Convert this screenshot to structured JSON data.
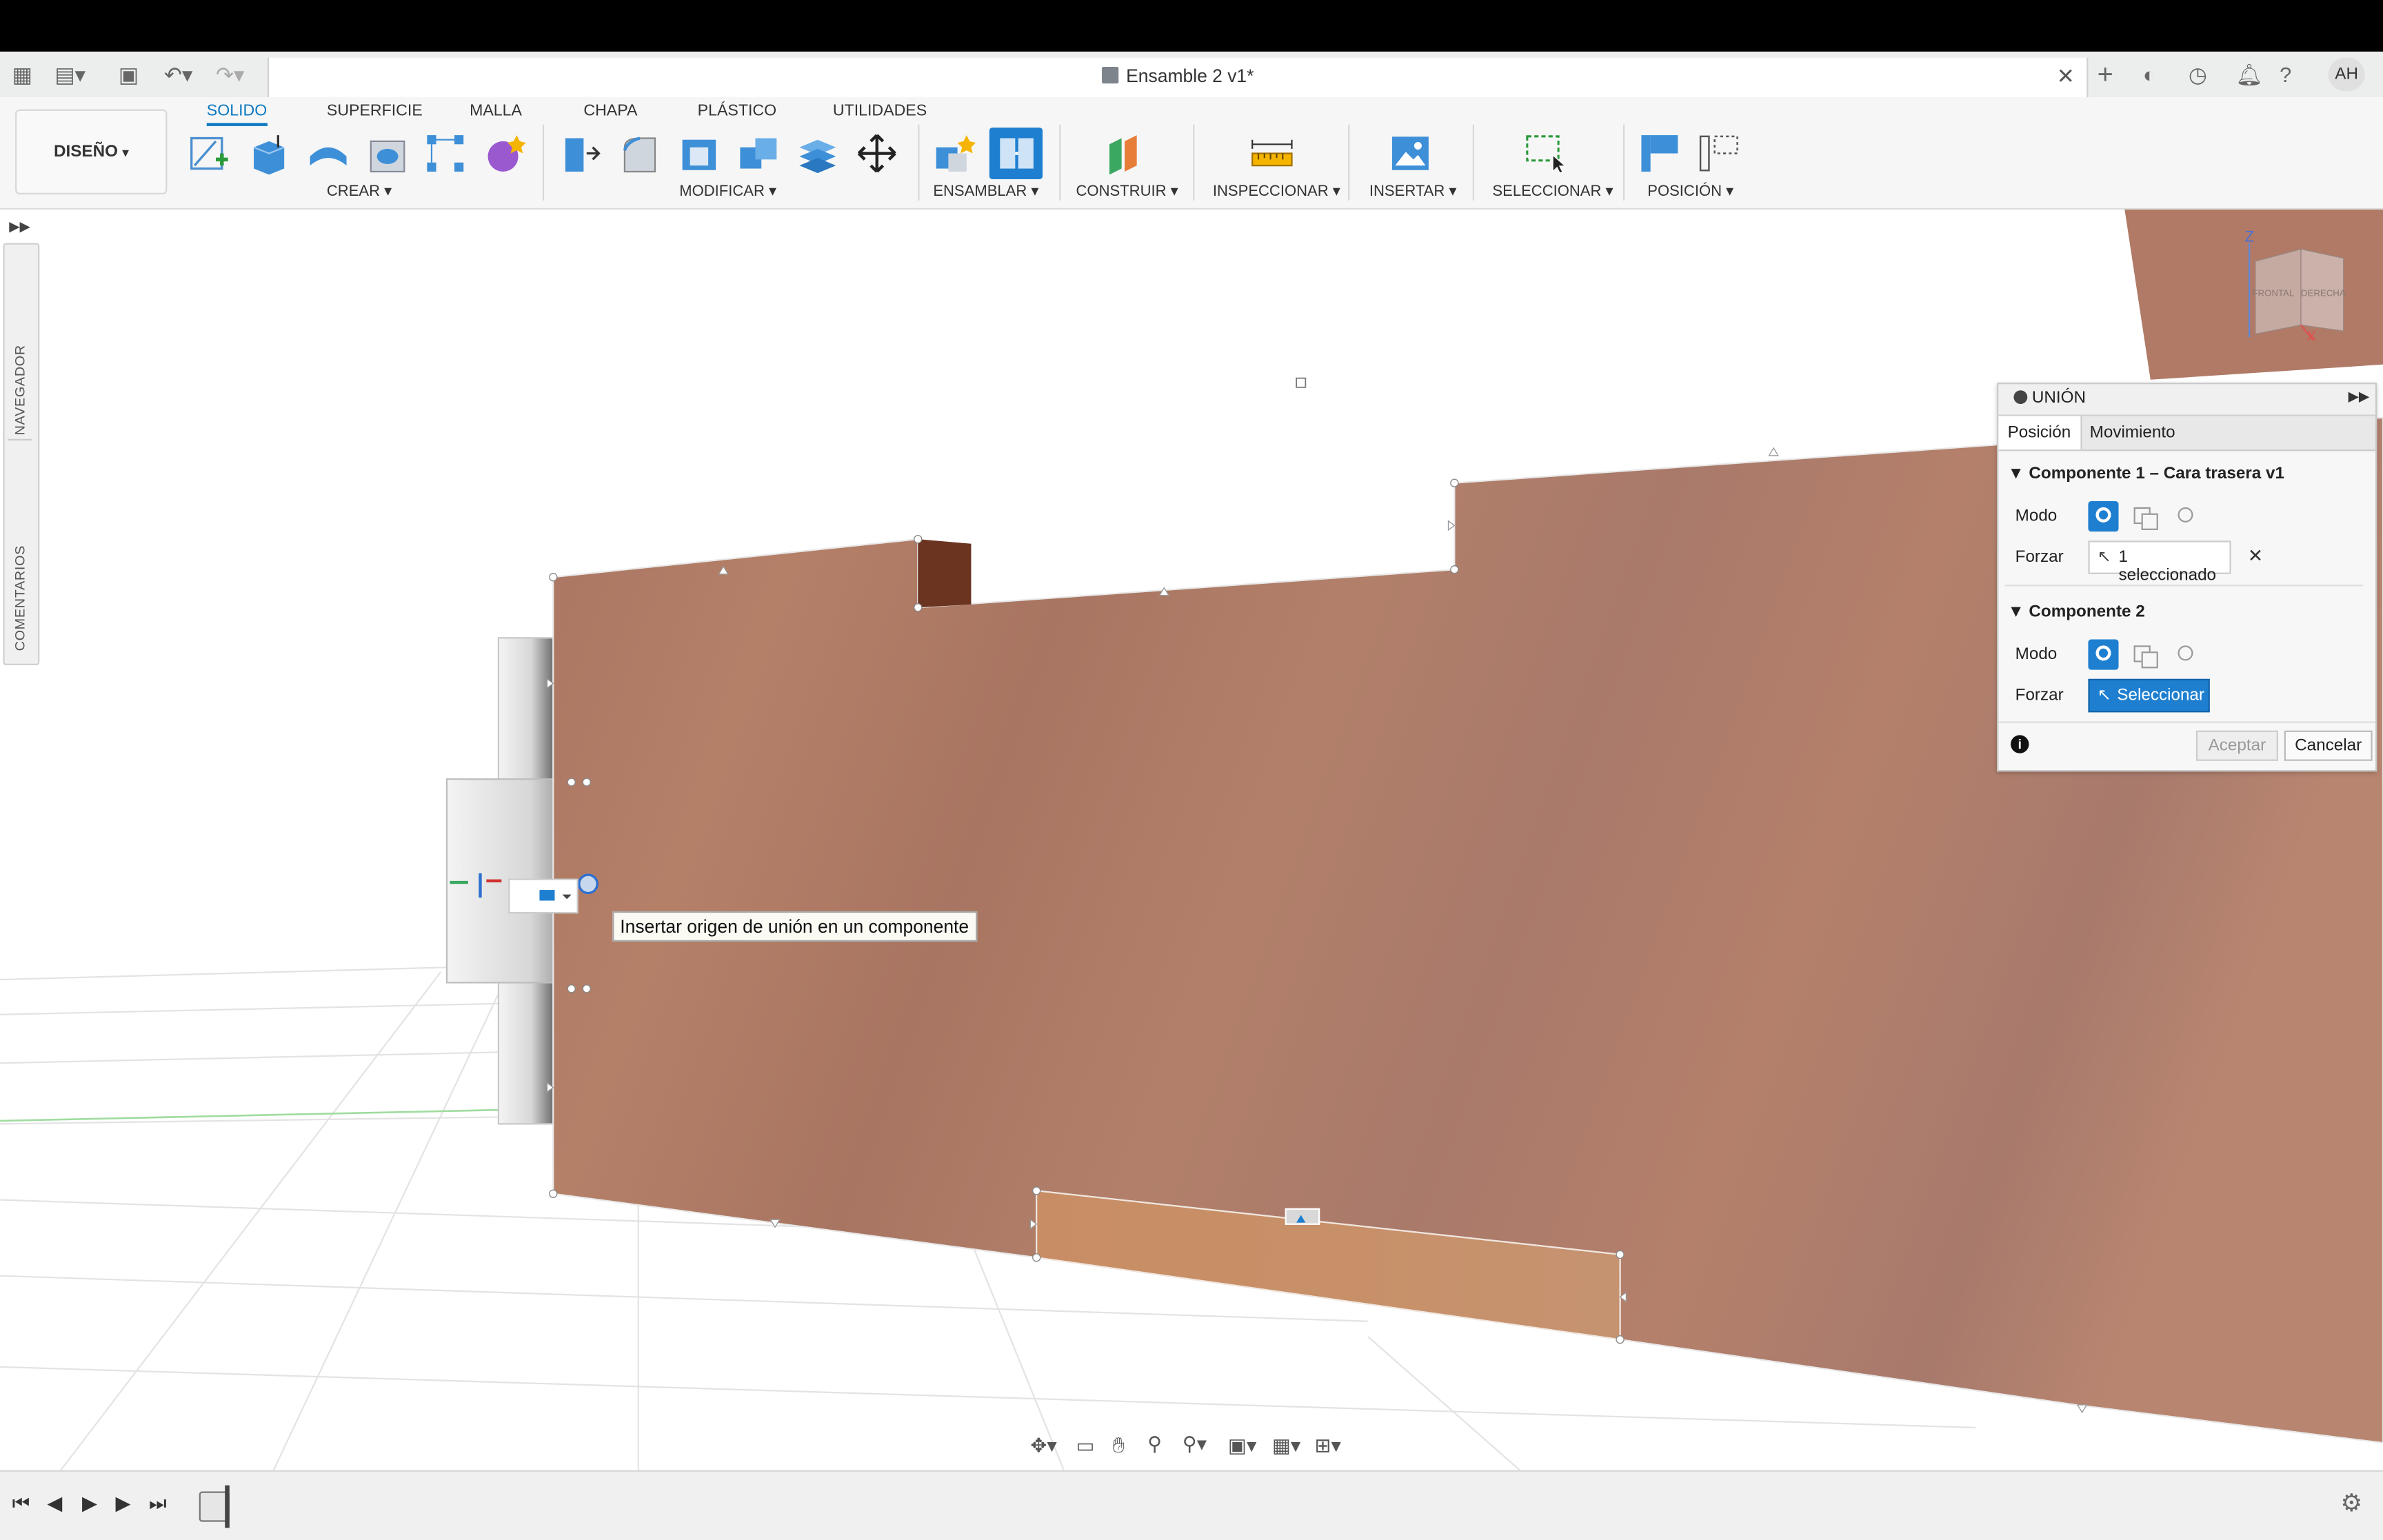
{
  "title_bar": {
    "document_title": "Ensamble 2 v1*",
    "user_initials": "AH"
  },
  "workspace": {
    "label": "DISEÑO"
  },
  "ribbon": {
    "tabs": [
      "SOLIDO",
      "SUPERFICIE",
      "MALLA",
      "CHAPA",
      "PLÁSTICO",
      "UTILIDADES"
    ],
    "groups": [
      "CREAR",
      "MODIFICAR",
      "ENSAMBLAR",
      "CONSTRUIR",
      "INSPECCIONAR",
      "INSERTAR",
      "SELECCIONAR",
      "POSICIÓN"
    ]
  },
  "sidebar": {
    "navigator_label": "NAVEGADOR",
    "comments_label": "COMENTARIOS"
  },
  "viewcube": {
    "front_label": "FRONTAL",
    "right_label": "DERECHA",
    "z_label": "Z",
    "x_label": "X"
  },
  "tooltip": {
    "text": "Insertar origen de unión en un componente"
  },
  "joint_panel": {
    "title": "UNIÓN",
    "tabs": [
      "Posición",
      "Movimiento"
    ],
    "component1": {
      "header": "Componente 1 – Cara trasera v1",
      "mode_label": "Modo",
      "snap_label": "Forzar",
      "snap_value": "1 seleccionado"
    },
    "component2": {
      "header": "Componente 2",
      "mode_label": "Modo",
      "snap_label": "Forzar",
      "snap_value": "Seleccionar"
    },
    "ok_label": "Aceptar",
    "cancel_label": "Cancelar"
  },
  "colors": {
    "accent": "#0a78c0",
    "wood": "#b07a62"
  }
}
